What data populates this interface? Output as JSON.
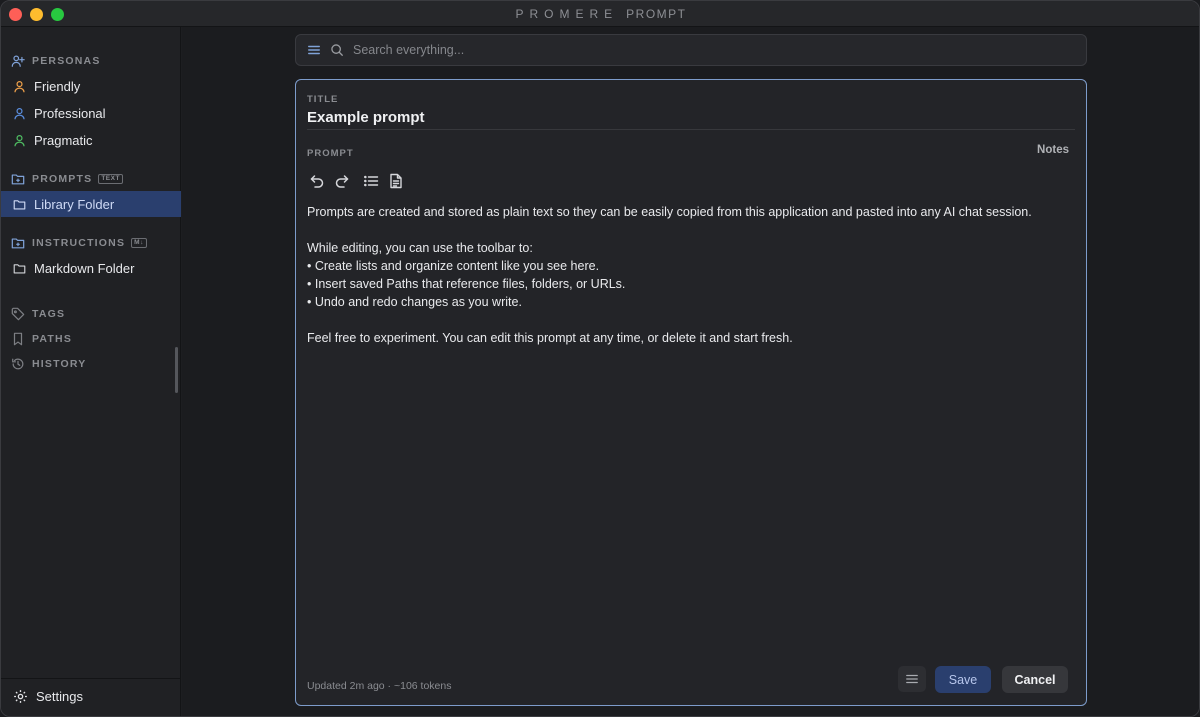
{
  "window": {
    "brand": "PROMERE",
    "subtitle": "PROMPT"
  },
  "sidebar": {
    "personas": {
      "header": "PERSONAS",
      "items": [
        {
          "label": "Friendly",
          "color": "#f0a14a"
        },
        {
          "label": "Professional",
          "color": "#5b8fe0"
        },
        {
          "label": "Pragmatic",
          "color": "#4fbf63"
        }
      ]
    },
    "prompts": {
      "header": "PROMPTS",
      "tag": "TEXT",
      "items": [
        {
          "label": "Library Folder",
          "active": true
        }
      ]
    },
    "instructions": {
      "header": "INSTRUCTIONS",
      "tag": "M↓",
      "items": [
        {
          "label": "Markdown Folder"
        }
      ]
    },
    "tags": {
      "header": "TAGS"
    },
    "paths": {
      "header": "PATHS"
    },
    "history": {
      "header": "HISTORY"
    },
    "settings": {
      "label": "Settings"
    }
  },
  "search": {
    "placeholder": "Search everything..."
  },
  "editor": {
    "title_label": "TITLE",
    "title": "Example prompt",
    "prompt_label": "PROMPT",
    "notes_label": "Notes",
    "toolbar": [
      "undo-icon",
      "redo-icon",
      "list-icon",
      "document-icon"
    ],
    "body": {
      "para1": "Prompts are created and stored as plain text so they can be easily copied from this application and pasted into any AI chat session.",
      "para2_intro": "While editing, you can use the toolbar to:",
      "bullet1": "• Create lists and organize content like you see here.",
      "bullet2": "• Insert saved Paths that reference files, folders, or URLs.",
      "bullet3": "• Undo and redo changes as you write.",
      "para3": "Feel free to experiment. You can edit this prompt at any time, or delete it and start fresh."
    },
    "footer": "Updated 2m ago · ~106 tokens",
    "save_label": "Save",
    "cancel_label": "Cancel"
  },
  "colors": {
    "accent": "#7d9ccb",
    "active_bg": "#2a3f6e"
  }
}
